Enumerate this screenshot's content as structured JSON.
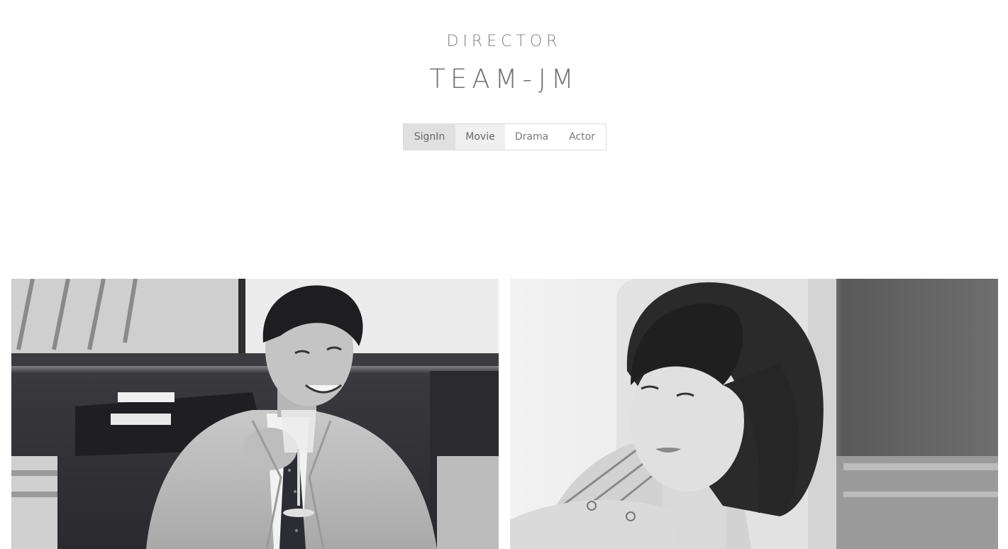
{
  "header": {
    "subtitle": "DIRECTOR",
    "title": "TEAM-JM"
  },
  "nav": {
    "items": [
      {
        "label": "SignIn"
      },
      {
        "label": "Movie"
      },
      {
        "label": "Drama"
      },
      {
        "label": "Actor"
      }
    ]
  },
  "gallery": {
    "photos": [
      {
        "subject": "man-in-suit-drinking"
      },
      {
        "subject": "woman-with-bob-haircut"
      }
    ]
  },
  "colors": {
    "text": "#808080",
    "nav_active": "#e0e0e0",
    "nav_hover": "#f0f0f0",
    "border": "#dcdcdc"
  }
}
